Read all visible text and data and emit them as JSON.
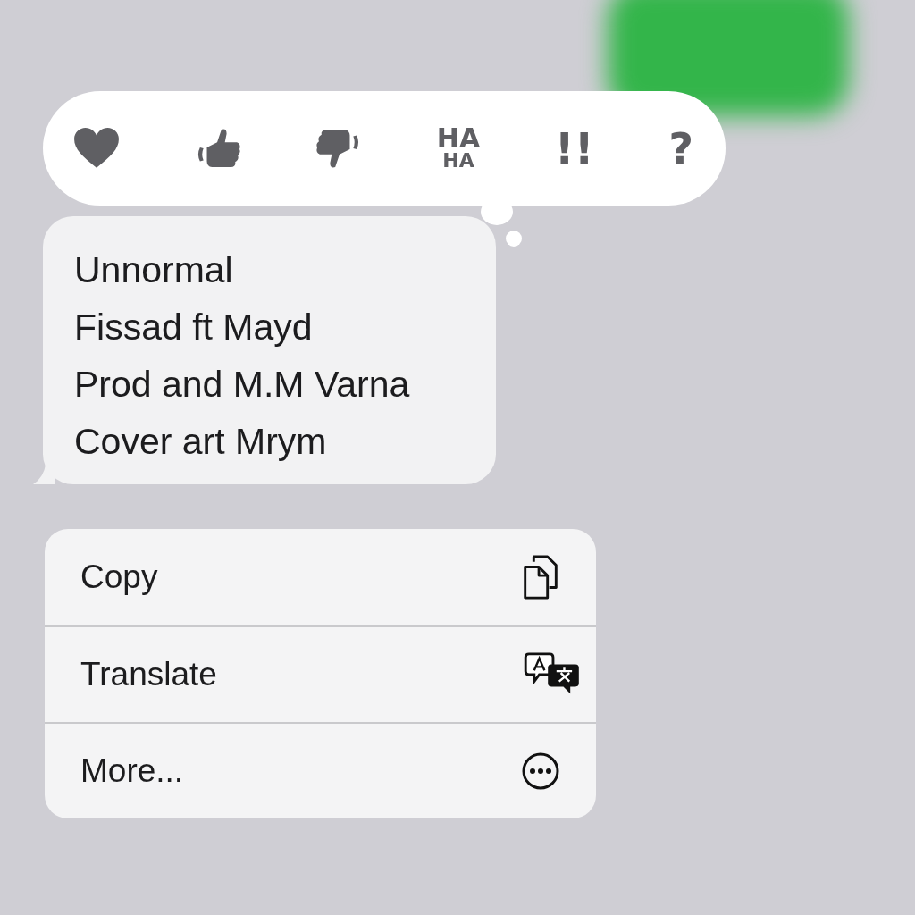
{
  "reactions": [
    {
      "kind": "heart"
    },
    {
      "kind": "thumbs-up"
    },
    {
      "kind": "thumbs-down"
    },
    {
      "kind": "haha",
      "lines": [
        "HA",
        "HA"
      ]
    },
    {
      "kind": "text",
      "text": "!!"
    },
    {
      "kind": "text",
      "text": "?"
    }
  ],
  "message": {
    "lines": [
      "Unnormal",
      "Fissad ft Mayd",
      "Prod and M.M Varna",
      "Cover art Mrym"
    ]
  },
  "menu": [
    {
      "label": "Copy",
      "kind": "copy"
    },
    {
      "label": "Translate",
      "kind": "translate"
    },
    {
      "label": "More...",
      "kind": "more"
    }
  ]
}
